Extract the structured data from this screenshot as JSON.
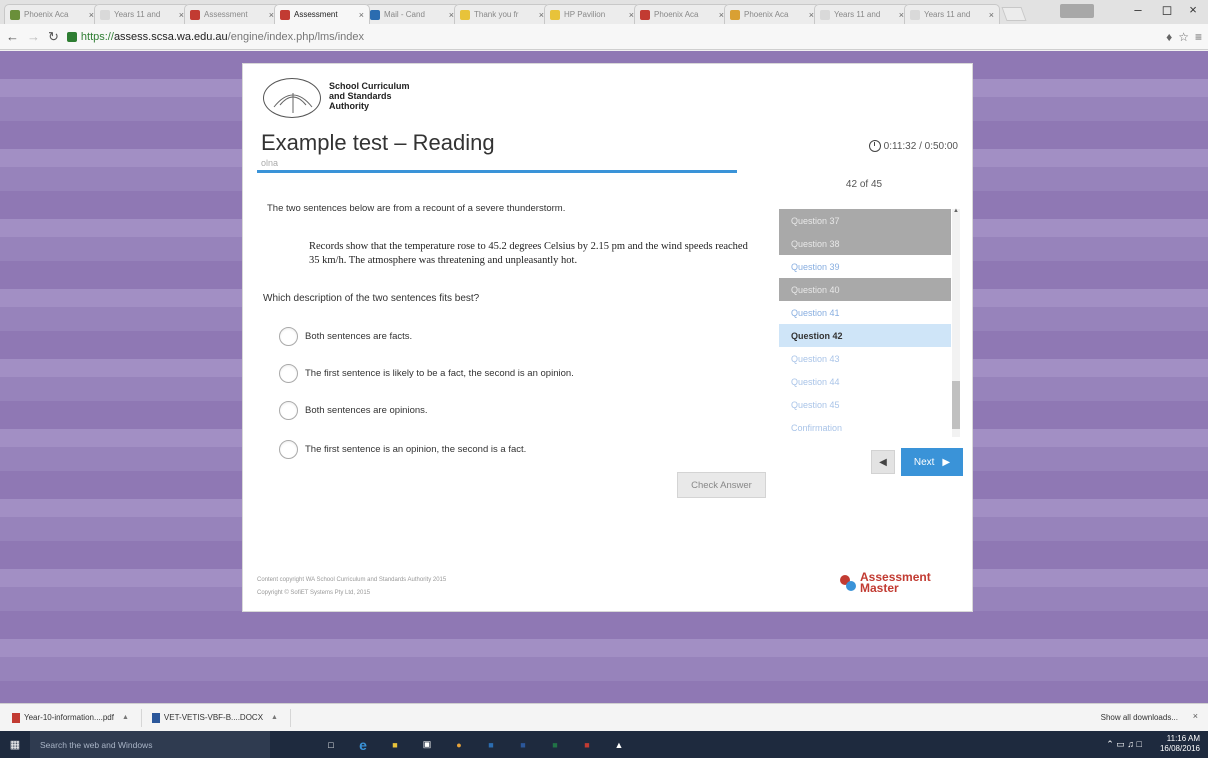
{
  "browser": {
    "tabs": [
      {
        "label": "Phoenix Aca",
        "color": "#6a8f3a",
        "active": false
      },
      {
        "label": "Years 11 and",
        "color": "#d9d9d9",
        "active": false
      },
      {
        "label": "Assessment",
        "color": "#c23b32",
        "active": false
      },
      {
        "label": "Assessment",
        "color": "#c23b32",
        "active": true
      },
      {
        "label": "Mail - Cand",
        "color": "#2b6cb0",
        "active": false
      },
      {
        "label": "Thank you fr",
        "color": "#e8c33a",
        "active": false
      },
      {
        "label": "HP Pavilion",
        "color": "#e8c33a",
        "active": false
      },
      {
        "label": "Phoenix Aca",
        "color": "#c23b32",
        "active": false
      },
      {
        "label": "Phoenix Aca",
        "color": "#d9a033",
        "active": false
      },
      {
        "label": "Years 11 and",
        "color": "#d9d9d9",
        "active": false
      },
      {
        "label": "Years 11 and",
        "color": "#d9d9d9",
        "active": false
      }
    ],
    "url_scheme": "https://",
    "url_host": "assess.scsa.wa.edu.au",
    "url_path": "/engine/index.php/lms/index",
    "window_controls": {
      "minimize": "–",
      "maximize": "◻",
      "close": "×"
    }
  },
  "test": {
    "logo_lines": [
      "School Curriculum",
      "and Standards",
      "Authority"
    ],
    "title": "Example test – Reading",
    "student": "olna",
    "progress_fraction": 1.0,
    "timer": "0:11:32 / 0:50:00",
    "stem": "The two sentences below are from a recount of a severe thunderstorm.",
    "extract": "Records show that the temperature rose to 45.2 degrees Celsius by 2.15 pm and the wind speeds reached 35 km/h. The atmosphere was threatening and unpleasantly hot.",
    "question": "Which description of the two sentences fits best?",
    "options": [
      "Both sentences are facts.",
      "The first sentence is likely to be a fact, the second is an opinion.",
      "Both sentences are opinions.",
      "The first sentence is an opinion, the second is a fact."
    ],
    "check_answer": "Check Answer"
  },
  "nav": {
    "counter": "42 of 45",
    "items": [
      {
        "label": "Question 37",
        "state": "visited"
      },
      {
        "label": "Question 38",
        "state": "visited"
      },
      {
        "label": "Question 39",
        "state": "unvisited"
      },
      {
        "label": "Question 40",
        "state": "visited"
      },
      {
        "label": "Question 41",
        "state": "unvisited"
      },
      {
        "label": "Question 42",
        "state": "current"
      },
      {
        "label": "Question 43",
        "state": "faint"
      },
      {
        "label": "Question 44",
        "state": "faint"
      },
      {
        "label": "Question 45",
        "state": "faint"
      },
      {
        "label": "Confirmation",
        "state": "faint"
      }
    ],
    "prev_icon": "triangle-left-icon",
    "next_label": "Next"
  },
  "footer": {
    "copyright1": "Content copyright WA School Curriculum and Standards Authority 2015",
    "copyright2": "Copyright © SofiET Systems Pty Ltd, 2015",
    "brand_line1": "Assessment",
    "brand_line2": "Master"
  },
  "downloads": {
    "items": [
      {
        "label": "Year-10-information....pdf",
        "color": "#c23b32"
      },
      {
        "label": "VET-VETIS-VBF-B....DOCX",
        "color": "#2b579a"
      }
    ],
    "show_all": "Show all downloads...",
    "close": "×"
  },
  "taskbar": {
    "search_placeholder": "Search the web and Windows",
    "time": "11:16 AM",
    "date": "16/08/2016"
  }
}
